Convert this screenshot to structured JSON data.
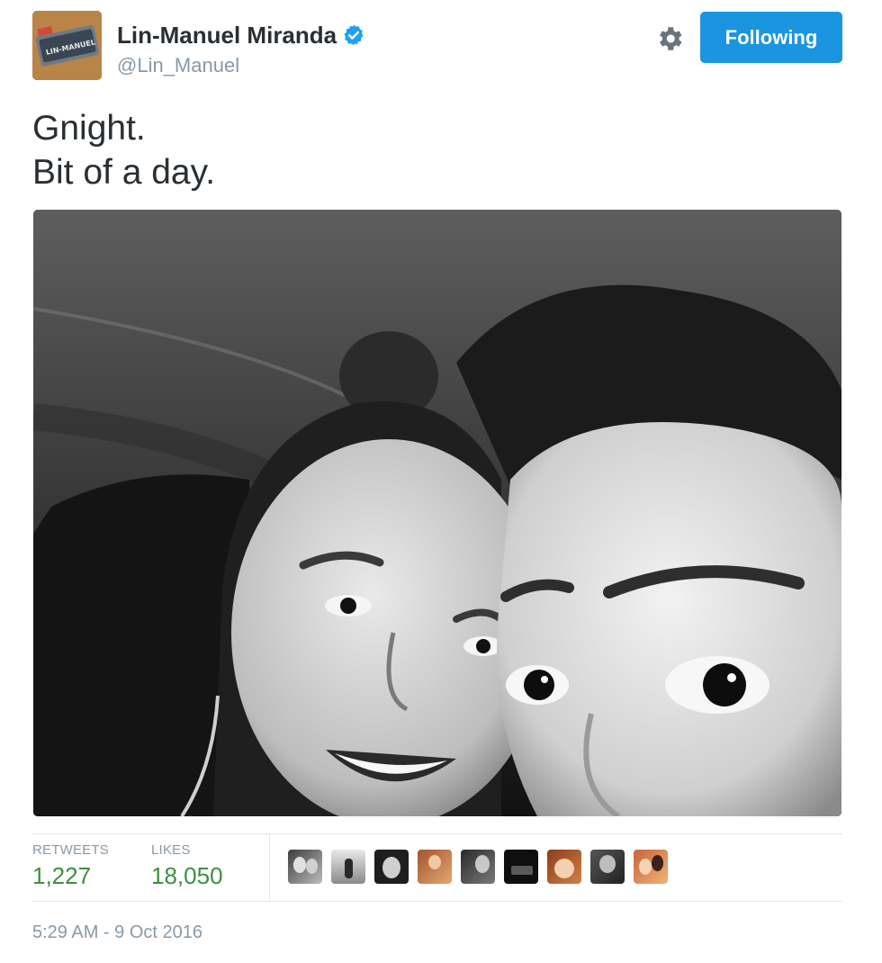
{
  "author": {
    "fullname": "Lin-Manuel Miranda",
    "screenname": "@Lin_Manuel",
    "verified_icon": "verified-badge-icon",
    "avatar_text": "LIN-MANUEL"
  },
  "header": {
    "follow_button_label": "Following",
    "settings_icon": "gear-icon",
    "accent_color": "#1b95e0"
  },
  "tweet": {
    "lines": [
      "Gnight.",
      "Bit of a day."
    ]
  },
  "stats": {
    "retweets_label": "RETWEETS",
    "retweets_value": "1,227",
    "likes_label": "LIKES",
    "likes_value": "18,050",
    "value_color": "#3e8e41"
  },
  "likers": {
    "count_shown": 9
  },
  "timestamp": "5:29 AM - 9 Oct 2016"
}
